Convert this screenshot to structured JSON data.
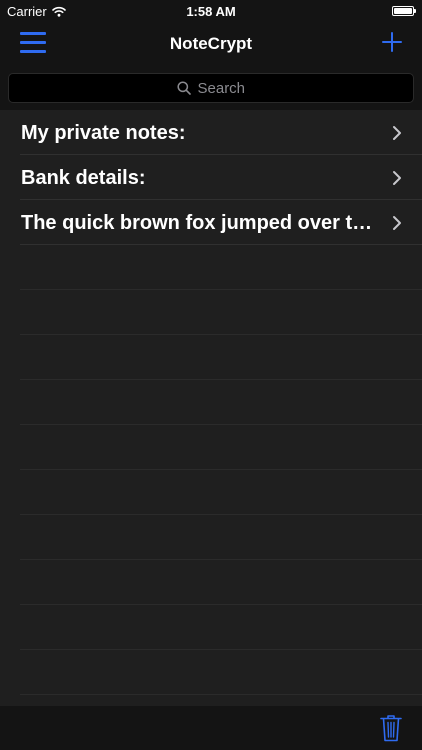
{
  "status_bar": {
    "carrier": "Carrier",
    "time": "1:58 AM",
    "wifi_icon": "wifi-icon",
    "battery_icon": "battery-icon",
    "battery_level": 1.0
  },
  "nav": {
    "title": "NoteCrypt",
    "menu_icon": "hamburger-menu-icon",
    "add_icon": "plus-icon"
  },
  "search": {
    "placeholder": "Search",
    "icon": "search-icon"
  },
  "notes": [
    {
      "title": "My private notes:"
    },
    {
      "title": "Bank details:"
    },
    {
      "title": "The quick brown fox jumped over the lazy dog"
    }
  ],
  "toolbar": {
    "trash_icon": "trash-icon"
  },
  "colors": {
    "accent": "#2f6bf0",
    "background": "#1f1f1f",
    "bars": "#141414",
    "separator": "#303030",
    "text": "#ffffff",
    "secondary_text": "#8a8a8f"
  }
}
